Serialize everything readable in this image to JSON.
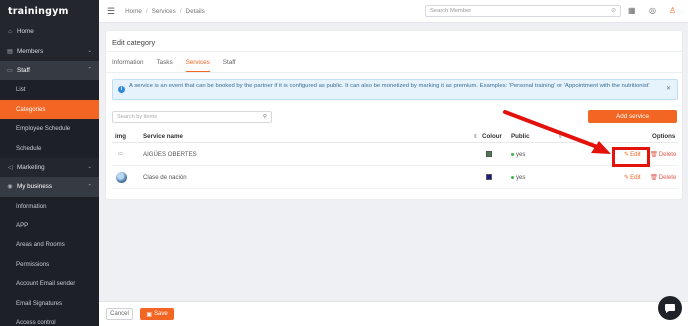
{
  "app": {
    "logo": "trainingym"
  },
  "sidebar": {
    "items": [
      {
        "label": "Home",
        "icon": "home-icon"
      },
      {
        "label": "Members",
        "icon": "id-card-icon"
      },
      {
        "label": "Staff",
        "icon": "folder-icon"
      }
    ],
    "staff_sub": [
      "List",
      "Categories",
      "Employee Schedule",
      "Schedule"
    ],
    "marketing": {
      "label": "Marketing",
      "icon": "megaphone-icon"
    },
    "business": {
      "label": "My business",
      "icon": "location-pin-icon"
    },
    "business_sub": [
      "Information",
      "APP",
      "Areas and Rooms",
      "Permissions",
      "Account Email sender",
      "Email Signatures",
      "Access control"
    ]
  },
  "topbar": {
    "breadcrumb": [
      "Home",
      "Services",
      "Details"
    ],
    "search_placeholder": "Search Member"
  },
  "card": {
    "title": "Edit category",
    "tabs": [
      "Information",
      "Tasks",
      "Services",
      "Staff"
    ],
    "active_tab": "Services",
    "alert": "A service is an event that can be booked by the partner if it is configured as public. It can also be monetized by marking it as premium. Examples: 'Personal training' or 'Appointment with the nutritionist'",
    "search_placeholder": "Search by items",
    "add_button": "Add service",
    "columns": {
      "img": "img",
      "name": "Service name",
      "colour": "Colour",
      "public": "Public",
      "options": "Options"
    },
    "rows": [
      {
        "name": "AIGÜES OBERTES",
        "colour": "#4a7a52",
        "public": "yes",
        "edit": "Edit",
        "delete": "Delete"
      },
      {
        "name": "Clase de nación",
        "colour": "#1f1a8c",
        "public": "yes",
        "edit": "Edit",
        "delete": "Delete"
      }
    ]
  },
  "footer": {
    "cancel": "Cancel",
    "save": "Save"
  },
  "colors": {
    "accent": "#f26522",
    "sidebar": "#23262d",
    "annotation": "#e3120b"
  }
}
